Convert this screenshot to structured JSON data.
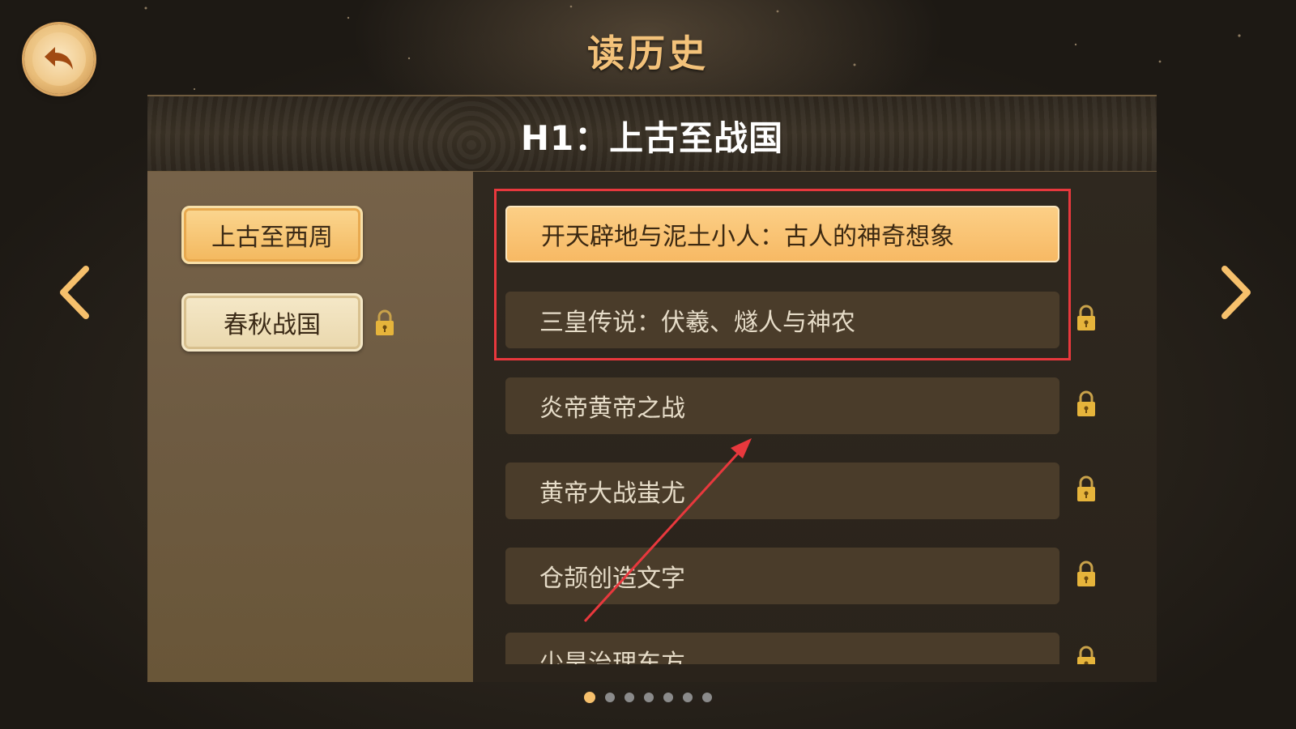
{
  "header": {
    "title": "读历史",
    "back_icon": "back-arrow-icon"
  },
  "banner": {
    "title": "H1：上古至战国"
  },
  "eras": [
    {
      "label": "上古至西周",
      "state": "selected"
    },
    {
      "label": "春秋战国",
      "state": "locked"
    }
  ],
  "lessons": [
    {
      "label": "开天辟地与泥土小人：古人的神奇想象",
      "state": "active"
    },
    {
      "label": "三皇传说：伏羲、燧人与神农",
      "state": "locked"
    },
    {
      "label": "炎帝黄帝之战",
      "state": "locked"
    },
    {
      "label": "黄帝大战蚩尤",
      "state": "locked"
    },
    {
      "label": "仓颉创造文字",
      "state": "locked"
    },
    {
      "label": "少昊治理东方",
      "state": "locked"
    }
  ],
  "pagination": {
    "total": 7,
    "current": 1
  },
  "colors": {
    "accent": "#f6c06c",
    "title": "#f3c27a",
    "annotation": "#e8383d"
  }
}
